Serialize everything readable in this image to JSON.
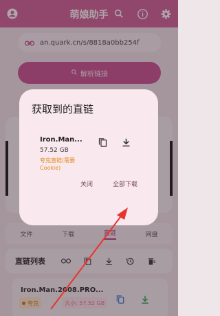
{
  "appbar": {
    "title": "萌娘助手",
    "icons": [
      "account-circle-icon",
      "search-icon",
      "info-icon",
      "settings-icon"
    ],
    "color": "#cf5c97"
  },
  "background": {
    "url_value": "an.quark.cn/s/8818a0bb254f",
    "parse_button": "解析链接",
    "tabs": [
      "文件",
      "下载",
      "直链",
      "网盘"
    ],
    "active_tab": "直链",
    "list_title": "直链列表",
    "list_item": {
      "name": "Iron.Man.2008.PRO...",
      "source": "夸克",
      "size": "大小: 57.52 GB"
    }
  },
  "dialog": {
    "title": "获取到的直链",
    "item": {
      "name": "Iron.Man...",
      "size": "57.52 GB",
      "tag": "夸克直链(需要Cookie)"
    },
    "close_label": "关闭",
    "download_all_label": "全部下载"
  },
  "annotation": {
    "arrow_color": "#e8342f"
  }
}
